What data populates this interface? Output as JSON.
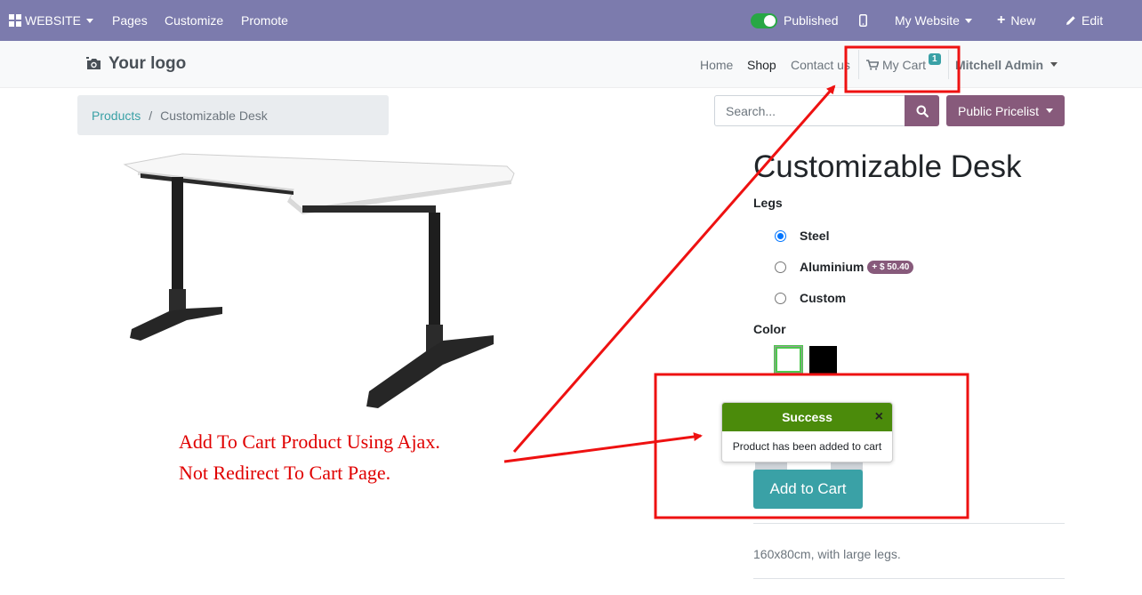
{
  "adminbar": {
    "website_label": "WEBSITE",
    "pages": "Pages",
    "customize": "Customize",
    "promote": "Promote",
    "published": "Published",
    "my_website": "My Website",
    "new": "New",
    "edit": "Edit"
  },
  "header": {
    "logo_text": "Your logo",
    "nav": [
      "Home",
      "Shop",
      "Contact us"
    ],
    "cart_label": "My Cart",
    "cart_count": "1",
    "user": "Mitchell Admin"
  },
  "breadcrumb": {
    "parent": "Products",
    "separator": "/",
    "current": "Customizable Desk"
  },
  "search": {
    "placeholder": "Search..."
  },
  "pricelist": {
    "label": "Public Pricelist"
  },
  "product": {
    "title": "Customizable Desk",
    "legs_label": "Legs",
    "legs_options": [
      {
        "label": "Steel",
        "selected": true
      },
      {
        "label": "Aluminium",
        "extra": "+ $ 50.40",
        "selected": false
      },
      {
        "label": "Custom",
        "selected": false
      }
    ],
    "color_label": "Color",
    "colors": [
      {
        "name": "White",
        "hex": "#ffffff",
        "selected": true
      },
      {
        "name": "Black",
        "hex": "#000000",
        "selected": false
      }
    ],
    "add_to_cart": "Add to Cart",
    "description": "160x80cm, with large legs."
  },
  "toast": {
    "title": "Success",
    "close": "×",
    "message": "Product has been added to cart"
  },
  "annotation": {
    "line1": "Add To Cart Product Using Ajax.",
    "line2": "Not Redirect To Cart Page."
  },
  "colors": {
    "admin_bar": "#7c7bad",
    "primary_purple": "#875a7b",
    "teal": "#3aa1a6",
    "toast_green": "#4b8b0b",
    "annotation_red": "#e00000"
  }
}
